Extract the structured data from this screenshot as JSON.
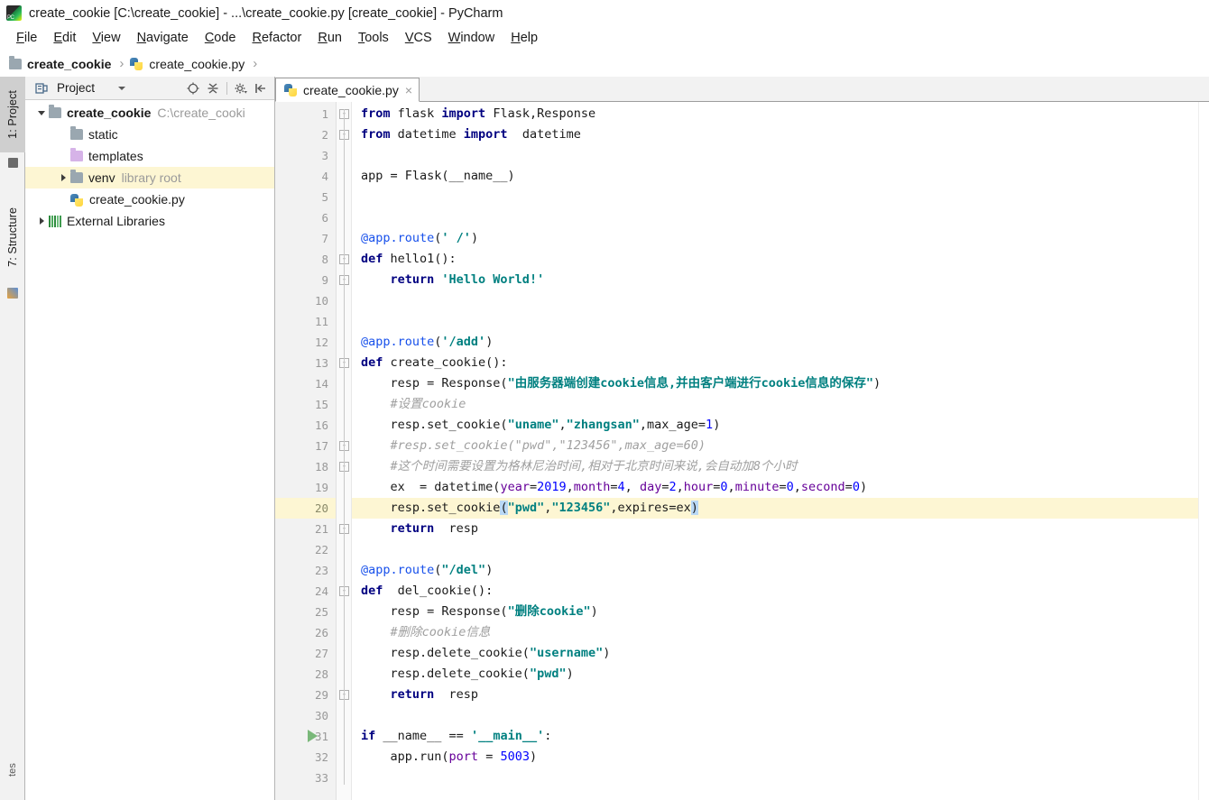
{
  "window": {
    "title": "create_cookie [C:\\create_cookie] - ...\\create_cookie.py [create_cookie] - PyCharm",
    "logo_icon": "pycharm-logo-icon"
  },
  "menubar": {
    "items": [
      {
        "label": "File"
      },
      {
        "label": "Edit"
      },
      {
        "label": "View"
      },
      {
        "label": "Navigate"
      },
      {
        "label": "Code"
      },
      {
        "label": "Refactor"
      },
      {
        "label": "Run"
      },
      {
        "label": "Tools"
      },
      {
        "label": "VCS"
      },
      {
        "label": "Window"
      },
      {
        "label": "Help"
      }
    ]
  },
  "breadcrumb": {
    "items": [
      {
        "label": "create_cookie",
        "icon": "folder-icon",
        "bold": true
      },
      {
        "label": "create_cookie.py",
        "icon": "python-file-icon",
        "bold": false
      }
    ],
    "separator": "›"
  },
  "left_toolwindow_strip": {
    "tabs": [
      {
        "label": "1: Project",
        "active": true
      },
      {
        "label": "7: Structure",
        "active": false
      },
      {
        "label": "tes",
        "active": false
      }
    ]
  },
  "project_panel": {
    "title": "Project",
    "header_icons": [
      "project-view-icon",
      "chevron-down-icon",
      "locate-target-icon",
      "collapse-all-icon",
      "settings-gear-icon",
      "hide-panel-icon"
    ],
    "tree": [
      {
        "label": "create_cookie",
        "path_hint": "C:\\create_cooki",
        "icon": "folder-icon",
        "bold": true,
        "indent": 0,
        "arrow": "open",
        "highlight": false
      },
      {
        "label": "static",
        "path_hint": "",
        "icon": "folder-icon",
        "bold": false,
        "indent": 1,
        "arrow": "none",
        "highlight": false
      },
      {
        "label": "templates",
        "path_hint": "",
        "icon": "folder-purple-icon",
        "bold": false,
        "indent": 1,
        "arrow": "none",
        "highlight": false
      },
      {
        "label": "venv",
        "path_hint": "library root",
        "icon": "folder-icon",
        "bold": false,
        "indent": 1,
        "arrow": "closed",
        "highlight": true
      },
      {
        "label": "create_cookie.py",
        "path_hint": "",
        "icon": "python-file-icon",
        "bold": false,
        "indent": 1,
        "arrow": "none",
        "highlight": false
      },
      {
        "label": "External Libraries",
        "path_hint": "",
        "icon": "library-icon",
        "bold": false,
        "indent": 0,
        "arrow": "closed",
        "highlight": false
      }
    ]
  },
  "editor": {
    "tabs": [
      {
        "label": "create_cookie.py",
        "icon": "python-file-icon",
        "close": "×",
        "active": true
      }
    ],
    "current_line": 20,
    "run_marker_line": 31,
    "lines": [
      {
        "n": 1,
        "tokens": [
          {
            "t": "from ",
            "c": "kw"
          },
          {
            "t": "flask ",
            "c": "pln"
          },
          {
            "t": "import ",
            "c": "kw"
          },
          {
            "t": "Flask,Response",
            "c": "pln"
          }
        ]
      },
      {
        "n": 2,
        "tokens": [
          {
            "t": "from ",
            "c": "kw"
          },
          {
            "t": "datetime ",
            "c": "pln"
          },
          {
            "t": "import ",
            "c": "kw"
          },
          {
            "t": " datetime",
            "c": "pln"
          }
        ]
      },
      {
        "n": 3,
        "tokens": []
      },
      {
        "n": 4,
        "tokens": [
          {
            "t": "app = Flask(__name__)",
            "c": "pln"
          }
        ]
      },
      {
        "n": 5,
        "tokens": []
      },
      {
        "n": 6,
        "tokens": []
      },
      {
        "n": 7,
        "tokens": [
          {
            "t": "@app.route",
            "c": "dec"
          },
          {
            "t": "(",
            "c": "pln"
          },
          {
            "t": "' /'",
            "c": "str"
          },
          {
            "t": ")",
            "c": "pln"
          }
        ]
      },
      {
        "n": 8,
        "tokens": [
          {
            "t": "def ",
            "c": "kw"
          },
          {
            "t": "hello1():",
            "c": "pln"
          }
        ]
      },
      {
        "n": 9,
        "tokens": [
          {
            "t": "    return ",
            "c": "kw"
          },
          {
            "t": "'Hello World!'",
            "c": "str"
          }
        ]
      },
      {
        "n": 10,
        "tokens": []
      },
      {
        "n": 11,
        "tokens": []
      },
      {
        "n": 12,
        "tokens": [
          {
            "t": "@app.route",
            "c": "dec"
          },
          {
            "t": "(",
            "c": "pln"
          },
          {
            "t": "'/add'",
            "c": "str"
          },
          {
            "t": ")",
            "c": "pln"
          }
        ]
      },
      {
        "n": 13,
        "tokens": [
          {
            "t": "def ",
            "c": "kw"
          },
          {
            "t": "create_cookie():",
            "c": "pln"
          }
        ]
      },
      {
        "n": 14,
        "tokens": [
          {
            "t": "    resp = Response(",
            "c": "pln"
          },
          {
            "t": "\"由服务器端创建cookie信息,并由客户端进行cookie信息的保存\"",
            "c": "str"
          },
          {
            "t": ")",
            "c": "pln"
          }
        ]
      },
      {
        "n": 15,
        "tokens": [
          {
            "t": "    #设置cookie",
            "c": "cmt"
          }
        ]
      },
      {
        "n": 16,
        "tokens": [
          {
            "t": "    resp.set_cookie(",
            "c": "pln"
          },
          {
            "t": "\"uname\"",
            "c": "str"
          },
          {
            "t": ",",
            "c": "pln"
          },
          {
            "t": "\"zhangsan\"",
            "c": "str"
          },
          {
            "t": ",max_age=",
            "c": "pln"
          },
          {
            "t": "1",
            "c": "num"
          },
          {
            "t": ")",
            "c": "pln"
          }
        ]
      },
      {
        "n": 17,
        "tokens": [
          {
            "t": "    #resp.set_cookie(\"pwd\",\"123456\",max_age=60)",
            "c": "cmt"
          }
        ]
      },
      {
        "n": 18,
        "tokens": [
          {
            "t": "    #这个时间需要设置为格林尼治时间,相对于北京时间来说,会自动加8个小时",
            "c": "cmt"
          }
        ]
      },
      {
        "n": 19,
        "tokens": [
          {
            "t": "    ex  = datetime(",
            "c": "pln"
          },
          {
            "t": "year",
            "c": "kwarg"
          },
          {
            "t": "=",
            "c": "pln"
          },
          {
            "t": "2019",
            "c": "num"
          },
          {
            "t": ",",
            "c": "pln"
          },
          {
            "t": "month",
            "c": "kwarg"
          },
          {
            "t": "=",
            "c": "pln"
          },
          {
            "t": "4",
            "c": "num"
          },
          {
            "t": ", ",
            "c": "pln"
          },
          {
            "t": "day",
            "c": "kwarg"
          },
          {
            "t": "=",
            "c": "pln"
          },
          {
            "t": "2",
            "c": "num"
          },
          {
            "t": ",",
            "c": "pln"
          },
          {
            "t": "hour",
            "c": "kwarg"
          },
          {
            "t": "=",
            "c": "pln"
          },
          {
            "t": "0",
            "c": "num"
          },
          {
            "t": ",",
            "c": "pln"
          },
          {
            "t": "minute",
            "c": "kwarg"
          },
          {
            "t": "=",
            "c": "pln"
          },
          {
            "t": "0",
            "c": "num"
          },
          {
            "t": ",",
            "c": "pln"
          },
          {
            "t": "second",
            "c": "kwarg"
          },
          {
            "t": "=",
            "c": "pln"
          },
          {
            "t": "0",
            "c": "num"
          },
          {
            "t": ")",
            "c": "pln"
          }
        ]
      },
      {
        "n": 20,
        "tokens": [
          {
            "t": "    resp.set_cookie",
            "c": "pln"
          },
          {
            "t": "(",
            "c": "brk"
          },
          {
            "t": "\"pwd\"",
            "c": "str"
          },
          {
            "t": ",",
            "c": "pln"
          },
          {
            "t": "\"123456\"",
            "c": "str"
          },
          {
            "t": ",expires=ex",
            "c": "pln"
          },
          {
            "t": ")",
            "c": "brk"
          }
        ]
      },
      {
        "n": 21,
        "tokens": [
          {
            "t": "    return ",
            "c": "kw"
          },
          {
            "t": " resp",
            "c": "pln"
          }
        ]
      },
      {
        "n": 22,
        "tokens": []
      },
      {
        "n": 23,
        "tokens": [
          {
            "t": "@app.route",
            "c": "dec"
          },
          {
            "t": "(",
            "c": "pln"
          },
          {
            "t": "\"/del\"",
            "c": "str"
          },
          {
            "t": ")",
            "c": "pln"
          }
        ]
      },
      {
        "n": 24,
        "tokens": [
          {
            "t": "def ",
            "c": "kw"
          },
          {
            "t": " del_cookie():",
            "c": "pln"
          }
        ]
      },
      {
        "n": 25,
        "tokens": [
          {
            "t": "    resp = Response(",
            "c": "pln"
          },
          {
            "t": "\"删除cookie\"",
            "c": "str"
          },
          {
            "t": ")",
            "c": "pln"
          }
        ]
      },
      {
        "n": 26,
        "tokens": [
          {
            "t": "    #删除cookie信息",
            "c": "cmt"
          }
        ]
      },
      {
        "n": 27,
        "tokens": [
          {
            "t": "    resp.delete_cookie(",
            "c": "pln"
          },
          {
            "t": "\"username\"",
            "c": "str"
          },
          {
            "t": ")",
            "c": "pln"
          }
        ]
      },
      {
        "n": 28,
        "tokens": [
          {
            "t": "    resp.delete_cookie(",
            "c": "pln"
          },
          {
            "t": "\"pwd\"",
            "c": "str"
          },
          {
            "t": ")",
            "c": "pln"
          }
        ]
      },
      {
        "n": 29,
        "tokens": [
          {
            "t": "    return ",
            "c": "kw"
          },
          {
            "t": " resp",
            "c": "pln"
          }
        ]
      },
      {
        "n": 30,
        "tokens": []
      },
      {
        "n": 31,
        "tokens": [
          {
            "t": "if ",
            "c": "kw"
          },
          {
            "t": "__name__ == ",
            "c": "pln"
          },
          {
            "t": "'__main__'",
            "c": "str"
          },
          {
            "t": ":",
            "c": "pln"
          }
        ]
      },
      {
        "n": 32,
        "tokens": [
          {
            "t": "    app.run(",
            "c": "pln"
          },
          {
            "t": "port",
            "c": "kwarg"
          },
          {
            "t": " = ",
            "c": "pln"
          },
          {
            "t": "5003",
            "c": "num"
          },
          {
            "t": ")",
            "c": "pln"
          }
        ]
      },
      {
        "n": 33,
        "tokens": []
      }
    ]
  },
  "colors": {
    "keyword": "#000080",
    "string": "#008080",
    "number": "#0000ff",
    "comment": "#a0a0a0",
    "decorator": "#1750eb",
    "kwarg": "#660099",
    "current_line_bg": "#fdf6d3",
    "bracket_match_bg": "#b9d8f5",
    "tree_highlight_bg": "#fdf6d3",
    "panel_bg": "#f2f2f2"
  }
}
